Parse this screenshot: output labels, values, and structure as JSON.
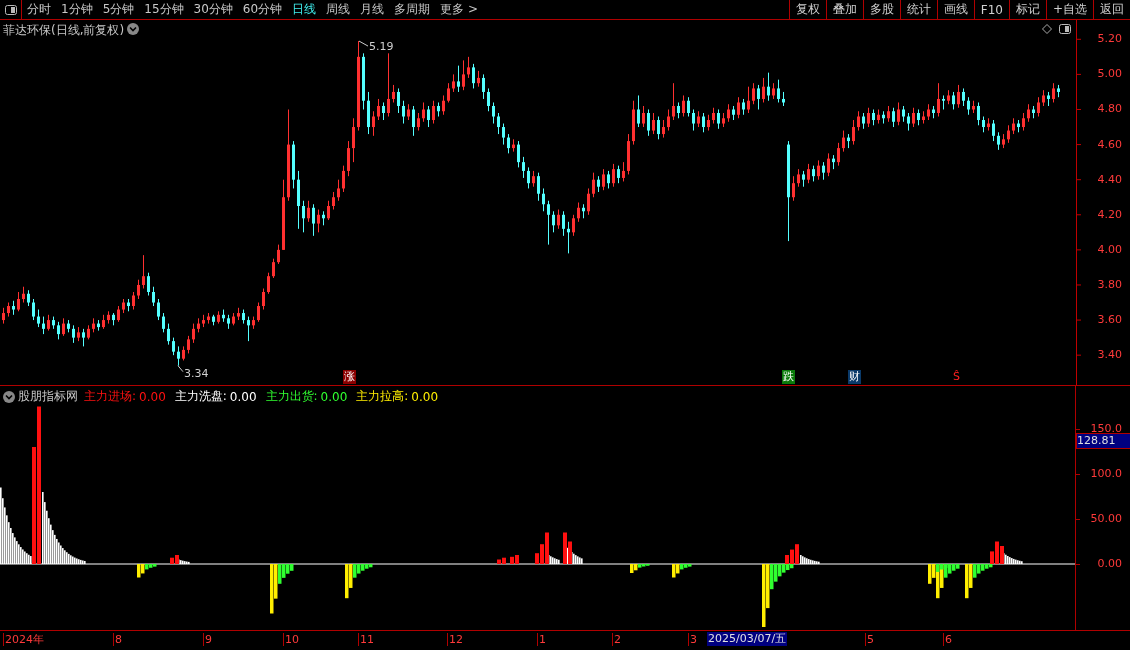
{
  "toolbar": {
    "periods": [
      {
        "label": "分时",
        "selected": false
      },
      {
        "label": "1分钟",
        "selected": false
      },
      {
        "label": "5分钟",
        "selected": false
      },
      {
        "label": "15分钟",
        "selected": false
      },
      {
        "label": "30分钟",
        "selected": false
      },
      {
        "label": "60分钟",
        "selected": false
      },
      {
        "label": "日线",
        "selected": true
      },
      {
        "label": "周线",
        "selected": false
      },
      {
        "label": "月线",
        "selected": false
      },
      {
        "label": "多周期",
        "selected": false
      },
      {
        "label": "更多 >",
        "selected": false
      }
    ],
    "actions": [
      "复权",
      "叠加",
      "多股",
      "统计",
      "画线",
      "F10",
      "标记",
      "+自选",
      "返回"
    ]
  },
  "chart": {
    "title": "菲达环保(日线,前复权)",
    "high_label": "5.19",
    "low_label": "3.34",
    "markers": [
      {
        "kind": "rise",
        "text": "涨"
      },
      {
        "kind": "fall",
        "text": "跌"
      },
      {
        "kind": "finance",
        "text": "财"
      },
      {
        "kind": "signal",
        "text": "Ŝ"
      }
    ],
    "chart_data": {
      "type": "candlestick",
      "ylim": [
        3.23,
        5.31
      ],
      "yticks": [
        {
          "value": 5.2,
          "label": "5.20"
        },
        {
          "value": 5.0,
          "label": "5.00"
        },
        {
          "value": 4.8,
          "label": "4.80"
        },
        {
          "value": 4.6,
          "label": "4.60"
        },
        {
          "value": 4.4,
          "label": "4.40"
        },
        {
          "value": 4.2,
          "label": "4.20"
        },
        {
          "value": 4.0,
          "label": "4.00"
        },
        {
          "value": 3.8,
          "label": "3.80"
        },
        {
          "value": 3.6,
          "label": "3.60"
        },
        {
          "value": 3.4,
          "label": "3.40"
        }
      ],
      "ohlc": [
        [
          3.6,
          3.67,
          3.58,
          3.64
        ],
        [
          3.64,
          3.7,
          3.62,
          3.68
        ],
        [
          3.68,
          3.71,
          3.63,
          3.66
        ],
        [
          3.66,
          3.76,
          3.65,
          3.72
        ],
        [
          3.72,
          3.79,
          3.7,
          3.75
        ],
        [
          3.75,
          3.77,
          3.68,
          3.7
        ],
        [
          3.7,
          3.72,
          3.6,
          3.62
        ],
        [
          3.62,
          3.66,
          3.56,
          3.58
        ],
        [
          3.58,
          3.62,
          3.52,
          3.55
        ],
        [
          3.55,
          3.63,
          3.54,
          3.6
        ],
        [
          3.6,
          3.62,
          3.55,
          3.57
        ],
        [
          3.57,
          3.59,
          3.49,
          3.52
        ],
        [
          3.52,
          3.61,
          3.51,
          3.58
        ],
        [
          3.58,
          3.6,
          3.53,
          3.55
        ],
        [
          3.55,
          3.57,
          3.47,
          3.5
        ],
        [
          3.5,
          3.56,
          3.48,
          3.53
        ],
        [
          3.53,
          3.55,
          3.45,
          3.5
        ],
        [
          3.5,
          3.57,
          3.49,
          3.55
        ],
        [
          3.55,
          3.61,
          3.53,
          3.58
        ],
        [
          3.58,
          3.6,
          3.54,
          3.56
        ],
        [
          3.56,
          3.63,
          3.55,
          3.6
        ],
        [
          3.6,
          3.65,
          3.58,
          3.63
        ],
        [
          3.63,
          3.64,
          3.57,
          3.6
        ],
        [
          3.6,
          3.68,
          3.59,
          3.66
        ],
        [
          3.66,
          3.72,
          3.64,
          3.7
        ],
        [
          3.7,
          3.72,
          3.65,
          3.68
        ],
        [
          3.68,
          3.76,
          3.66,
          3.74
        ],
        [
          3.74,
          3.83,
          3.72,
          3.8
        ],
        [
          3.8,
          3.97,
          3.78,
          3.85
        ],
        [
          3.85,
          3.87,
          3.74,
          3.76
        ],
        [
          3.76,
          3.79,
          3.68,
          3.7
        ],
        [
          3.7,
          3.72,
          3.6,
          3.62
        ],
        [
          3.62,
          3.64,
          3.53,
          3.55
        ],
        [
          3.55,
          3.58,
          3.46,
          3.48
        ],
        [
          3.48,
          3.5,
          3.4,
          3.42
        ],
        [
          3.42,
          3.45,
          3.34,
          3.38
        ],
        [
          3.38,
          3.45,
          3.37,
          3.43
        ],
        [
          3.43,
          3.51,
          3.41,
          3.49
        ],
        [
          3.49,
          3.58,
          3.47,
          3.55
        ],
        [
          3.55,
          3.61,
          3.53,
          3.58
        ],
        [
          3.58,
          3.63,
          3.56,
          3.6
        ],
        [
          3.6,
          3.64,
          3.58,
          3.62
        ],
        [
          3.62,
          3.63,
          3.57,
          3.59
        ],
        [
          3.59,
          3.65,
          3.58,
          3.63
        ],
        [
          3.63,
          3.66,
          3.59,
          3.61
        ],
        [
          3.61,
          3.63,
          3.55,
          3.58
        ],
        [
          3.58,
          3.64,
          3.57,
          3.62
        ],
        [
          3.62,
          3.67,
          3.6,
          3.64
        ],
        [
          3.64,
          3.66,
          3.58,
          3.6
        ],
        [
          3.6,
          3.62,
          3.48,
          3.57
        ],
        [
          3.57,
          3.62,
          3.55,
          3.6
        ],
        [
          3.6,
          3.7,
          3.59,
          3.68
        ],
        [
          3.68,
          3.78,
          3.66,
          3.76
        ],
        [
          3.76,
          3.87,
          3.75,
          3.85
        ],
        [
          3.85,
          3.95,
          3.84,
          3.93
        ],
        [
          3.93,
          4.03,
          3.92,
          4.0
        ],
        [
          4.0,
          4.4,
          4.0,
          4.3
        ],
        [
          4.3,
          4.8,
          4.28,
          4.6
        ],
        [
          4.6,
          4.62,
          4.35,
          4.4
        ],
        [
          4.4,
          4.45,
          4.12,
          4.25
        ],
        [
          4.25,
          4.28,
          4.1,
          4.18
        ],
        [
          4.18,
          4.28,
          4.16,
          4.24
        ],
        [
          4.24,
          4.26,
          4.08,
          4.15
        ],
        [
          4.15,
          4.23,
          4.1,
          4.2
        ],
        [
          4.2,
          4.22,
          4.14,
          4.18
        ],
        [
          4.18,
          4.28,
          4.17,
          4.25
        ],
        [
          4.25,
          4.33,
          4.23,
          4.3
        ],
        [
          4.3,
          4.4,
          4.28,
          4.35
        ],
        [
          4.35,
          4.48,
          4.33,
          4.45
        ],
        [
          4.45,
          4.62,
          4.42,
          4.58
        ],
        [
          4.58,
          4.75,
          4.5,
          4.7
        ],
        [
          4.7,
          5.19,
          4.68,
          5.1
        ],
        [
          5.1,
          5.12,
          4.8,
          4.85
        ],
        [
          4.85,
          4.9,
          4.66,
          4.7
        ],
        [
          4.7,
          4.79,
          4.65,
          4.76
        ],
        [
          4.76,
          4.86,
          4.74,
          4.82
        ],
        [
          4.82,
          4.84,
          4.74,
          4.78
        ],
        [
          4.78,
          5.12,
          4.76,
          4.86
        ],
        [
          4.86,
          4.94,
          4.84,
          4.9
        ],
        [
          4.9,
          4.92,
          4.78,
          4.82
        ],
        [
          4.82,
          4.85,
          4.72,
          4.76
        ],
        [
          4.76,
          4.83,
          4.74,
          4.8
        ],
        [
          4.8,
          4.82,
          4.65,
          4.7
        ],
        [
          4.7,
          4.78,
          4.68,
          4.75
        ],
        [
          4.75,
          4.84,
          4.73,
          4.8
        ],
        [
          4.8,
          4.82,
          4.7,
          4.74
        ],
        [
          4.74,
          4.85,
          4.72,
          4.82
        ],
        [
          4.82,
          4.84,
          4.76,
          4.79
        ],
        [
          4.79,
          4.88,
          4.77,
          4.85
        ],
        [
          4.85,
          4.95,
          4.84,
          4.92
        ],
        [
          4.92,
          5.0,
          4.9,
          4.96
        ],
        [
          4.96,
          5.05,
          4.9,
          4.93
        ],
        [
          4.93,
          5.08,
          4.91,
          5.0
        ],
        [
          5.0,
          5.1,
          4.98,
          5.04
        ],
        [
          5.04,
          5.06,
          4.92,
          4.95
        ],
        [
          4.95,
          5.02,
          4.93,
          4.98
        ],
        [
          4.98,
          5.0,
          4.86,
          4.9
        ],
        [
          4.9,
          4.92,
          4.79,
          4.82
        ],
        [
          4.82,
          4.84,
          4.72,
          4.76
        ],
        [
          4.76,
          4.78,
          4.66,
          4.7
        ],
        [
          4.7,
          4.72,
          4.6,
          4.64
        ],
        [
          4.64,
          4.66,
          4.55,
          4.58
        ],
        [
          4.58,
          4.63,
          4.56,
          4.6
        ],
        [
          4.6,
          4.62,
          4.47,
          4.5
        ],
        [
          4.5,
          4.53,
          4.41,
          4.45
        ],
        [
          4.45,
          4.47,
          4.35,
          4.38
        ],
        [
          4.38,
          4.45,
          4.36,
          4.42
        ],
        [
          4.42,
          4.44,
          4.28,
          4.32
        ],
        [
          4.32,
          4.35,
          4.22,
          4.26
        ],
        [
          4.26,
          4.28,
          4.03,
          4.2
        ],
        [
          4.2,
          4.22,
          4.1,
          4.14
        ],
        [
          4.14,
          4.23,
          4.12,
          4.2
        ],
        [
          4.2,
          4.22,
          4.08,
          4.12
        ],
        [
          4.12,
          4.16,
          3.98,
          4.1
        ],
        [
          4.1,
          4.2,
          4.08,
          4.18
        ],
        [
          4.18,
          4.27,
          4.16,
          4.24
        ],
        [
          4.24,
          4.26,
          4.18,
          4.22
        ],
        [
          4.22,
          4.35,
          4.2,
          4.32
        ],
        [
          4.32,
          4.44,
          4.3,
          4.4
        ],
        [
          4.4,
          4.42,
          4.33,
          4.36
        ],
        [
          4.36,
          4.46,
          4.34,
          4.43
        ],
        [
          4.43,
          4.45,
          4.35,
          4.38
        ],
        [
          4.38,
          4.49,
          4.36,
          4.46
        ],
        [
          4.46,
          4.48,
          4.38,
          4.41
        ],
        [
          4.41,
          4.5,
          4.39,
          4.45
        ],
        [
          4.45,
          4.66,
          4.43,
          4.62
        ],
        [
          4.62,
          4.85,
          4.6,
          4.8
        ],
        [
          4.8,
          4.88,
          4.7,
          4.72
        ],
        [
          4.72,
          4.82,
          4.7,
          4.78
        ],
        [
          4.78,
          4.8,
          4.65,
          4.68
        ],
        [
          4.68,
          4.78,
          4.66,
          4.74
        ],
        [
          4.74,
          4.76,
          4.63,
          4.66
        ],
        [
          4.66,
          4.74,
          4.64,
          4.7
        ],
        [
          4.7,
          4.8,
          4.68,
          4.76
        ],
        [
          4.76,
          4.95,
          4.74,
          4.82
        ],
        [
          4.82,
          4.84,
          4.75,
          4.78
        ],
        [
          4.78,
          4.88,
          4.76,
          4.85
        ],
        [
          4.85,
          4.87,
          4.76,
          4.78
        ],
        [
          4.78,
          4.8,
          4.68,
          4.72
        ],
        [
          4.72,
          4.79,
          4.7,
          4.76
        ],
        [
          4.76,
          4.78,
          4.67,
          4.7
        ],
        [
          4.7,
          4.77,
          4.68,
          4.74
        ],
        [
          4.74,
          4.81,
          4.72,
          4.78
        ],
        [
          4.78,
          4.8,
          4.69,
          4.72
        ],
        [
          4.72,
          4.78,
          4.7,
          4.75
        ],
        [
          4.75,
          4.83,
          4.73,
          4.8
        ],
        [
          4.8,
          4.82,
          4.74,
          4.77
        ],
        [
          4.77,
          4.87,
          4.75,
          4.84
        ],
        [
          4.84,
          4.86,
          4.77,
          4.8
        ],
        [
          4.8,
          4.93,
          4.78,
          4.85
        ],
        [
          4.85,
          4.95,
          4.83,
          4.92
        ],
        [
          4.92,
          4.94,
          4.8,
          4.86
        ],
        [
          4.86,
          4.98,
          4.84,
          4.93
        ],
        [
          4.93,
          5.01,
          4.85,
          4.88
        ],
        [
          4.88,
          4.95,
          4.86,
          4.92
        ],
        [
          4.92,
          4.97,
          4.84,
          4.86
        ],
        [
          4.86,
          4.9,
          4.82,
          4.84
        ],
        [
          4.6,
          4.62,
          4.05,
          4.3
        ],
        [
          4.3,
          4.42,
          4.28,
          4.38
        ],
        [
          4.38,
          4.46,
          4.36,
          4.43
        ],
        [
          4.43,
          4.45,
          4.36,
          4.4
        ],
        [
          4.4,
          4.49,
          4.38,
          4.46
        ],
        [
          4.46,
          4.48,
          4.39,
          4.42
        ],
        [
          4.42,
          4.51,
          4.4,
          4.48
        ],
        [
          4.48,
          4.5,
          4.4,
          4.44
        ],
        [
          4.44,
          4.55,
          4.42,
          4.52
        ],
        [
          4.52,
          4.54,
          4.46,
          4.5
        ],
        [
          4.5,
          4.61,
          4.48,
          4.58
        ],
        [
          4.58,
          4.68,
          4.56,
          4.64
        ],
        [
          4.64,
          4.66,
          4.58,
          4.62
        ],
        [
          4.62,
          4.74,
          4.6,
          4.7
        ],
        [
          4.7,
          4.79,
          4.68,
          4.76
        ],
        [
          4.76,
          4.78,
          4.69,
          4.72
        ],
        [
          4.72,
          4.81,
          4.7,
          4.78
        ],
        [
          4.78,
          4.8,
          4.71,
          4.74
        ],
        [
          4.74,
          4.8,
          4.72,
          4.77
        ],
        [
          4.77,
          4.79,
          4.72,
          4.75
        ],
        [
          4.75,
          4.82,
          4.73,
          4.79
        ],
        [
          4.79,
          4.81,
          4.7,
          4.73
        ],
        [
          4.73,
          4.84,
          4.71,
          4.8
        ],
        [
          4.8,
          4.82,
          4.73,
          4.76
        ],
        [
          4.76,
          4.78,
          4.68,
          4.72
        ],
        [
          4.72,
          4.81,
          4.7,
          4.78
        ],
        [
          4.78,
          4.8,
          4.71,
          4.74
        ],
        [
          4.74,
          4.79,
          4.72,
          4.76
        ],
        [
          4.76,
          4.83,
          4.74,
          4.8
        ],
        [
          4.8,
          4.82,
          4.75,
          4.78
        ],
        [
          4.78,
          4.95,
          4.76,
          4.86
        ],
        [
          4.86,
          4.88,
          4.8,
          4.85
        ],
        [
          4.85,
          4.91,
          4.83,
          4.88
        ],
        [
          4.88,
          4.9,
          4.8,
          4.83
        ],
        [
          4.83,
          4.94,
          4.81,
          4.9
        ],
        [
          4.9,
          4.92,
          4.82,
          4.85
        ],
        [
          4.85,
          4.87,
          4.77,
          4.8
        ],
        [
          4.8,
          4.85,
          4.78,
          4.82
        ],
        [
          4.82,
          4.84,
          4.71,
          4.74
        ],
        [
          4.74,
          4.76,
          4.67,
          4.7
        ],
        [
          4.7,
          4.75,
          4.68,
          4.72
        ],
        [
          4.72,
          4.74,
          4.62,
          4.65
        ],
        [
          4.65,
          4.67,
          4.57,
          4.6
        ],
        [
          4.6,
          4.66,
          4.58,
          4.63
        ],
        [
          4.63,
          4.71,
          4.61,
          4.68
        ],
        [
          4.68,
          4.75,
          4.66,
          4.72
        ],
        [
          4.72,
          4.74,
          4.67,
          4.7
        ],
        [
          4.7,
          4.78,
          4.68,
          4.75
        ],
        [
          4.75,
          4.83,
          4.73,
          4.8
        ],
        [
          4.8,
          4.82,
          4.75,
          4.78
        ],
        [
          4.78,
          4.87,
          4.76,
          4.84
        ],
        [
          4.84,
          4.91,
          4.82,
          4.88
        ],
        [
          4.88,
          4.9,
          4.82,
          4.86
        ],
        [
          4.86,
          4.95,
          4.84,
          4.92
        ],
        [
          4.92,
          4.94,
          4.87,
          4.9
        ]
      ]
    }
  },
  "indicator": {
    "name": "股朋指标网",
    "legend": [
      {
        "kind": "entry",
        "label": "主力进场:",
        "value": "0.00"
      },
      {
        "kind": "washout",
        "label": "主力洗盘:",
        "value": "0.00"
      },
      {
        "kind": "outflow",
        "label": "主力出货:",
        "value": "0.00"
      },
      {
        "kind": "pump",
        "label": "主力拉高:",
        "value": "0.00"
      }
    ],
    "y_ticks": [
      "150.0",
      "100.0",
      "50.00",
      "0.00"
    ],
    "cursor_value": "128.81"
  },
  "date_axis": {
    "labels": [
      "2024年",
      "8",
      "9",
      "10",
      "11",
      "12",
      "1",
      "2",
      "3",
      "5",
      "6"
    ],
    "cursor_date": "2025/03/07/五"
  }
}
